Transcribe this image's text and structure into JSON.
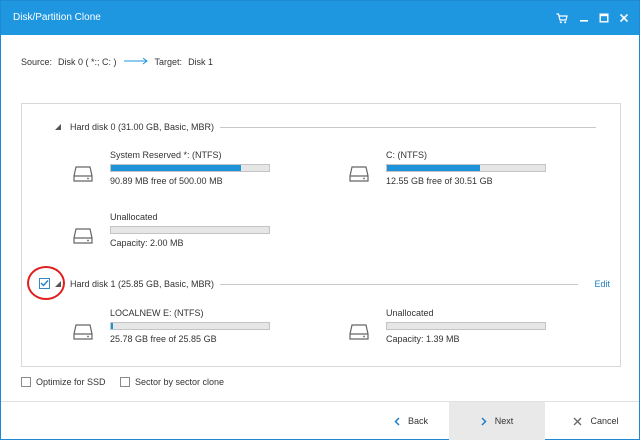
{
  "window": {
    "title": "Disk/Partition Clone"
  },
  "source_target": {
    "source_label": "Source:",
    "source_value": "Disk 0 ( *:; C: )",
    "target_label": "Target:",
    "target_value": "Disk 1"
  },
  "disks": [
    {
      "label": "Hard disk 0 (31.00 GB, Basic, MBR)",
      "checked": false,
      "partitions": [
        {
          "name": "System Reserved *: (NTFS)",
          "info": "90.89 MB free of 500.00 MB",
          "used_fraction": 0.82
        },
        {
          "name": "C: (NTFS)",
          "info": "12.55 GB free of 30.51 GB",
          "used_fraction": 0.59
        },
        {
          "name": "Unallocated",
          "info": "Capacity: 2.00 MB",
          "used_fraction": 0.0
        }
      ]
    },
    {
      "label": "Hard disk 1 (25.85 GB, Basic, MBR)",
      "checked": true,
      "edit_label": "Edit",
      "partitions": [
        {
          "name": "LOCALNEW E: (NTFS)",
          "info": "25.78 GB free of 25.85 GB",
          "used_fraction": 0.01
        },
        {
          "name": "Unallocated",
          "info": "Capacity: 1.39 MB",
          "used_fraction": 0.0
        }
      ]
    }
  ],
  "options": {
    "optimize_ssd": "Optimize for SSD",
    "sector_clone": "Sector by sector clone"
  },
  "buttons": {
    "back": "Back",
    "next": "Next",
    "cancel": "Cancel"
  },
  "colors": {
    "accent": "#1e96e0",
    "highlight_circle": "#e01f1f"
  },
  "icons": [
    "cart-icon",
    "minimize-icon",
    "maximize-icon",
    "close-icon",
    "arrow-right-icon",
    "hard-drive-icon",
    "collapse-triangle-icon",
    "checkmark-icon",
    "chevron-left-icon",
    "chevron-right-icon",
    "x-icon"
  ]
}
